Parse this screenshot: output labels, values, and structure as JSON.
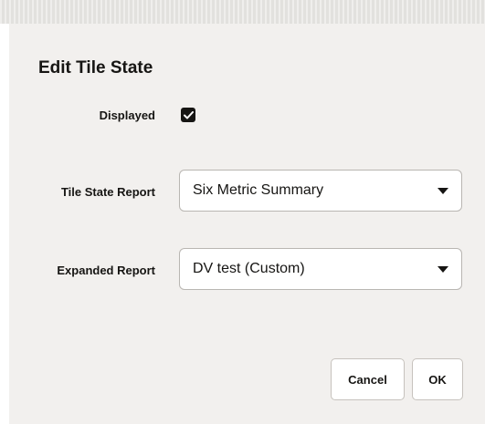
{
  "dialog": {
    "title": "Edit Tile State",
    "displayed": {
      "label": "Displayed",
      "checked": true
    },
    "tile_state_report": {
      "label": "Tile State Report",
      "value": "Six Metric Summary"
    },
    "expanded_report": {
      "label": "Expanded Report",
      "value": "DV test (Custom)"
    },
    "buttons": {
      "cancel": "Cancel",
      "ok": "OK"
    }
  },
  "icons": {
    "checkbox_check": "check-icon",
    "dropdown_arrow": "chevron-down-icon"
  },
  "colors": {
    "dialog_background": "#f2f0ee",
    "text": "#161513",
    "field_border": "#b9b6b2"
  }
}
